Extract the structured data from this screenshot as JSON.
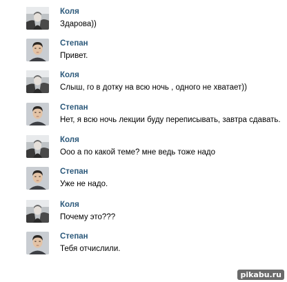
{
  "messages": [
    {
      "author": "Коля",
      "text": "Здарова))",
      "avatar": "kolya-avatar"
    },
    {
      "author": "Степан",
      "text": "Привет.",
      "avatar": "stepan-avatar"
    },
    {
      "author": "Коля",
      "text": "Слыш, го в дотку на всю ночь , одного не хватает))",
      "avatar": "kolya-avatar"
    },
    {
      "author": "Степан",
      "text": "Нет, я всю ночь лекции буду переписывать, завтра сдавать.",
      "avatar": "stepan-avatar"
    },
    {
      "author": "Коля",
      "text": "Ооо а по какой теме? мне ведь тоже надо",
      "avatar": "kolya-avatar"
    },
    {
      "author": "Степан",
      "text": "Уже не надо.",
      "avatar": "stepan-avatar"
    },
    {
      "author": "Коля",
      "text": "Почему это???",
      "avatar": "kolya-avatar"
    },
    {
      "author": "Степан",
      "text": "Тебя отчислили.",
      "avatar": "stepan-avatar"
    }
  ],
  "colors": {
    "author_link": "#2b587a",
    "message_text": "#000000"
  },
  "watermark": "pikabu.ru"
}
